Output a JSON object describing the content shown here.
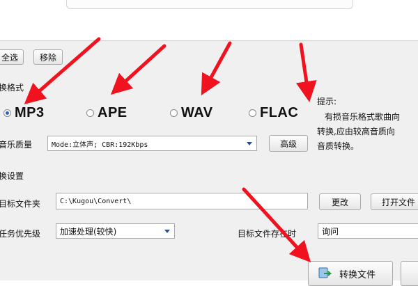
{
  "toolbar": {
    "select_all_label": "全选",
    "remove_label": "移除"
  },
  "format_section": {
    "title": "换格式",
    "options": [
      {
        "label": "MP3",
        "selected": true
      },
      {
        "label": "APE",
        "selected": false
      },
      {
        "label": "WAV",
        "selected": false
      },
      {
        "label": "FLAC",
        "selected": false
      }
    ],
    "quality_label": "音乐质量",
    "quality_value": "Mode:立体声; CBR:192Kbps",
    "advanced_label": "高级"
  },
  "hint": {
    "title": "提示:",
    "line1": "有损音乐格式歌曲向",
    "line2": "转换,应由较高音质向",
    "line3": "音质转换。"
  },
  "settings_section": {
    "title": "换设置",
    "target_folder_label": "目标文件夹",
    "target_folder_value": "C:\\Kugou\\Convert\\",
    "change_label": "更改",
    "open_folder_label": "打开文件",
    "priority_label": "任务优先级",
    "priority_value": "加速处理(较快)",
    "exists_label": "目标文件存在时",
    "exists_value": "询问"
  },
  "actions": {
    "convert_label": "转换文件"
  },
  "colors": {
    "arrow": "#f0121e",
    "panel": "#f0f0f0"
  }
}
